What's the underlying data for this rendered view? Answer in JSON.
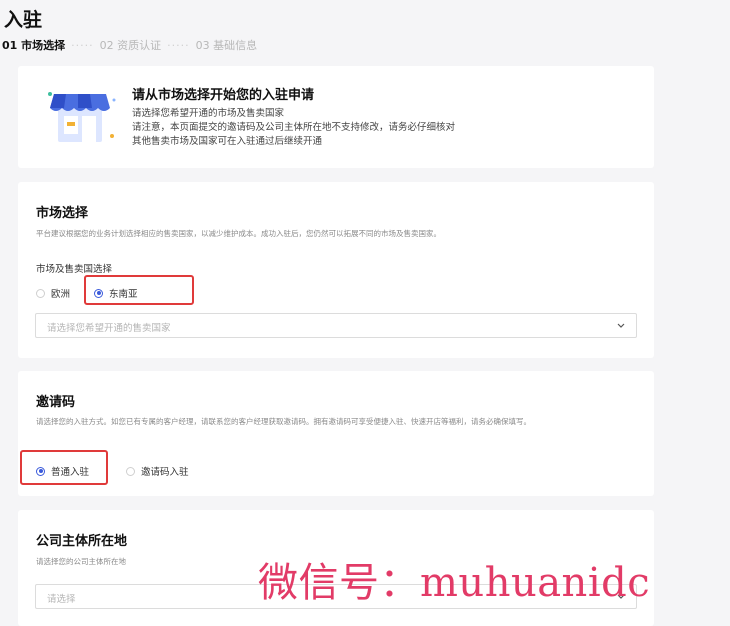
{
  "header": {
    "title": "入驻",
    "steps": [
      {
        "label": "01 市场选择",
        "active": true
      },
      {
        "label": "02 资质认证",
        "active": false
      },
      {
        "label": "03 基础信息",
        "active": false
      }
    ],
    "separator": "·····"
  },
  "intro": {
    "title": "请从市场选择开始您的入驻申请",
    "lines": [
      "请选择您希望开通的市场及售卖国家",
      "请注意，本页面提交的邀请码及公司主体所在地不支持修改，请务必仔细核对",
      "其他售卖市场及国家可在入驻通过后继续开通"
    ]
  },
  "market": {
    "title": "市场选择",
    "desc": "平台建议根据您的业务计划选择相应的售卖国家，以减少维护成本。成功入驻后，您仍然可以拓展不同的市场及售卖国家。",
    "field_label": "市场及售卖国选择",
    "options": [
      {
        "label": "欧洲",
        "checked": false
      },
      {
        "label": "东南亚",
        "checked": true
      }
    ],
    "select_placeholder": "请选择您希望开通的售卖国家"
  },
  "invite": {
    "title": "邀请码",
    "desc": "请选择您的入驻方式。如您已有专属的客户经理，请联系您的客户经理获取邀请码。拥有邀请码可享受便捷入驻、快速开店等福利，请务必确保填写。",
    "options": [
      {
        "label": "普通入驻",
        "checked": true
      },
      {
        "label": "邀请码入驻",
        "checked": false
      }
    ]
  },
  "company": {
    "title": "公司主体所在地",
    "desc": "请选择您的公司主体所在地",
    "select_placeholder": "请选择"
  },
  "watermark": "微信号：muhuanidc",
  "colors": {
    "accent": "#3b5bdb",
    "highlight": "#e03a3a",
    "watermark": "#e23b67",
    "background": "#f5f5f7"
  },
  "icons": [
    "store-illustration-icon",
    "chevron-down-icon"
  ]
}
